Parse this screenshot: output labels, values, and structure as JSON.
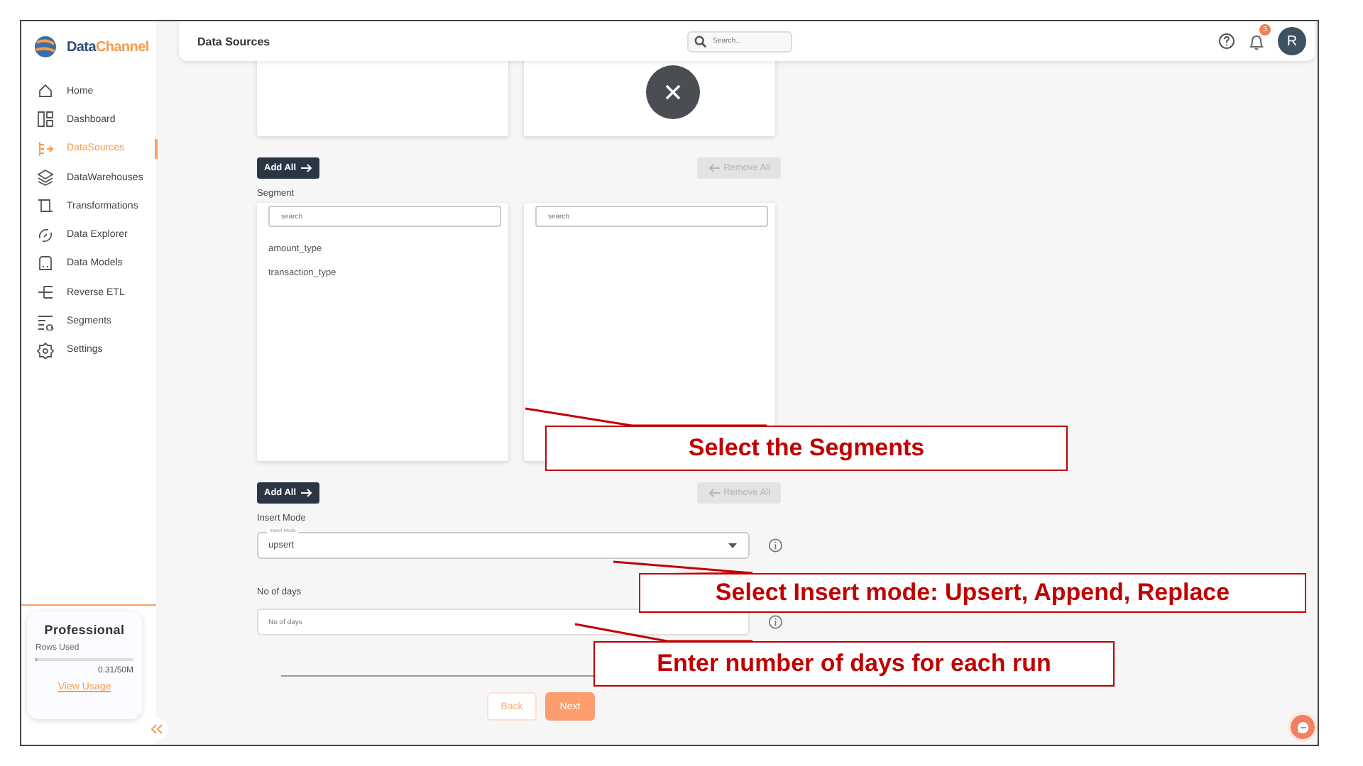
{
  "sidebar": {
    "logo_parts": [
      "Data",
      "Channel"
    ],
    "items": [
      {
        "label": "Home",
        "selected": false
      },
      {
        "label": "Dashboard",
        "selected": false
      },
      {
        "label": "DataSources",
        "selected": true
      },
      {
        "label": "DataWarehouses",
        "selected": false
      },
      {
        "label": "Transformations",
        "selected": false
      },
      {
        "label": "Data Explorer",
        "selected": false
      },
      {
        "label": "Data Models",
        "selected": false
      },
      {
        "label": "Reverse ETL",
        "selected": false
      },
      {
        "label": "Segments",
        "selected": false
      },
      {
        "label": "Settings",
        "selected": false
      }
    ],
    "plan": {
      "name": "Professional",
      "rows_label": "Rows Used",
      "level": 0.01,
      "usage": "0.31/50M",
      "link": "View Usage"
    }
  },
  "header": {
    "title": "Data Sources",
    "search_placeholder": "Search...",
    "notifications": "3",
    "avatar": "R"
  },
  "form": {
    "transfer_bars": [
      {
        "add": "Add All",
        "remove": "Remove All",
        "remove_disabled": true
      },
      {
        "add": "Add All",
        "remove": "Remove All",
        "remove_disabled": true
      }
    ],
    "segment": {
      "label": "Segment",
      "available_placeholder": "search",
      "chosen_placeholder": "search",
      "available": [
        "amount_type",
        "transaction_type"
      ]
    },
    "insert_mode": {
      "label": "Insert Mode",
      "field_label": "Insert Mode",
      "value": "upsert"
    },
    "days": {
      "label": "No of days",
      "placeholder": "No of days"
    },
    "buttons": {
      "back": "Back",
      "next": "Next"
    }
  },
  "annotations": [
    {
      "text": "Select the Segments"
    },
    {
      "text": "Select Insert mode: Upsert, Append, Replace"
    },
    {
      "text": "Enter number of days for each run"
    }
  ]
}
